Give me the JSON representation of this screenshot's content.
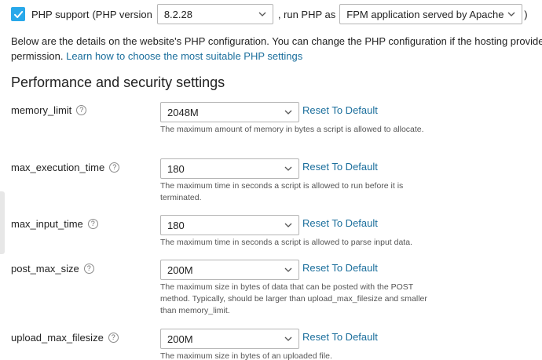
{
  "php_support": {
    "checkbox_checked": true,
    "label_prefix": "PHP support",
    "version_label": "(PHP version",
    "version_value": "8.2.28",
    "run_as_label": ", run PHP as",
    "handler_value": "FPM application served by Apache",
    "trailing": ")"
  },
  "description": {
    "line1": "Below are the details on the website's PHP configuration. You can change the PHP configuration if the hosting provide",
    "line2_text": "permission.",
    "learn_link": "Learn how to choose the most suitable PHP settings"
  },
  "section_title": "Performance and security settings",
  "reset_label": "Reset To Default",
  "help_glyph": "?",
  "settings": [
    {
      "name": "memory_limit",
      "value": "2048M",
      "hint": "The maximum amount of memory in bytes a script is allowed to allocate."
    },
    {
      "name": "max_execution_time",
      "value": "180",
      "hint": "The maximum time in seconds a script is allowed to run before it is terminated."
    },
    {
      "name": "max_input_time",
      "value": "180",
      "hint": "The maximum time in seconds a script is allowed to parse input data."
    },
    {
      "name": "post_max_size",
      "value": "200M",
      "hint": "The maximum size in bytes of data that can be posted with the POST method. Typically, should be larger than upload_max_filesize and smaller than memory_limit."
    },
    {
      "name": "upload_max_filesize",
      "value": "200M",
      "hint": "The maximum size in bytes of an uploaded file."
    }
  ],
  "colors": {
    "accent": "#28a8ea",
    "link": "#1a6e9c"
  },
  "icons": [
    "checkmark-icon",
    "chevron-down-icon",
    "help-icon"
  ]
}
